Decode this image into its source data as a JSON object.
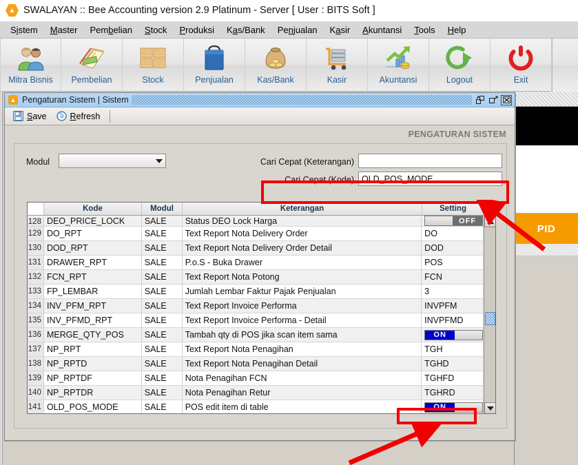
{
  "window": {
    "logo_icon": "hexagon-logo-icon",
    "title": "SWALAYAN :: Bee Accounting version 2.9 Platinum - Server  [ User : BITS Soft ]"
  },
  "menubar": {
    "items": [
      {
        "label": "Sistem",
        "mnemonic": "i"
      },
      {
        "label": "Master",
        "mnemonic": "M"
      },
      {
        "label": "Pembelian",
        "mnemonic": "b"
      },
      {
        "label": "Stock",
        "mnemonic": "S"
      },
      {
        "label": "Produksi",
        "mnemonic": "P"
      },
      {
        "label": "Kas/Bank",
        "mnemonic": "a"
      },
      {
        "label": "Penjualan",
        "mnemonic": "n"
      },
      {
        "label": "Kasir",
        "mnemonic": "a"
      },
      {
        "label": "Akuntansi",
        "mnemonic": "A"
      },
      {
        "label": "Tools",
        "mnemonic": "T"
      },
      {
        "label": "Help",
        "mnemonic": "H"
      }
    ]
  },
  "toolbar": {
    "buttons": [
      {
        "label": "Mitra Bisnis",
        "icon": "two-people-icon"
      },
      {
        "label": "Pembelian",
        "icon": "books-ledger-icon"
      },
      {
        "label": "Stock",
        "icon": "boxes-icon"
      },
      {
        "label": "Penjualan",
        "icon": "shopping-bag-icon"
      },
      {
        "label": "Kas/Bank",
        "icon": "money-bag-icon"
      },
      {
        "label": "Kasir",
        "icon": "cash-cart-icon"
      },
      {
        "label": "Akuntansi",
        "icon": "growth-chart-icon"
      },
      {
        "label": "Logout",
        "icon": "logout-arrow-icon"
      },
      {
        "label": "Exit",
        "icon": "power-off-icon"
      }
    ]
  },
  "mdi": {
    "icon": "hexagon-logo-icon",
    "title": "Pengaturan Sistem | Sistem",
    "window_buttons": [
      {
        "name": "restore-button",
        "glyph": "⤵"
      },
      {
        "name": "maximize-button",
        "glyph": "⤴"
      },
      {
        "name": "close-button",
        "glyph": "☒"
      }
    ],
    "tools": [
      {
        "label": "Save",
        "mnemonic": "S",
        "icon": "floppy-save-icon"
      },
      {
        "label": "Refresh",
        "mnemonic": "R",
        "icon": "refresh-circle-icon"
      }
    ],
    "page_title": "PENGATURAN SISTEM"
  },
  "form": {
    "modul_label": "Modul",
    "modul_value": "",
    "modul_placeholder": "",
    "cari_keterangan_label": "Cari Cepat (Keterangan)",
    "cari_keterangan_value": "",
    "cari_kode_label": "Cari Cepat (Kode)",
    "cari_kode_value": "OLD_POS_MODE"
  },
  "grid": {
    "columns": [
      "",
      "Kode",
      "Modul",
      "Keterangan",
      "Setting"
    ],
    "rows": [
      {
        "n": "128",
        "kode": "DEO_PRICE_LOCK",
        "modul": "SALE",
        "keterangan": "Status DEO Lock Harga",
        "setting": "OFF",
        "setting_type": "toggle"
      },
      {
        "n": "129",
        "kode": "DO_RPT",
        "modul": "SALE",
        "keterangan": "Text Report Nota Delivery Order",
        "setting": "DO",
        "setting_type": "text"
      },
      {
        "n": "130",
        "kode": "DOD_RPT",
        "modul": "SALE",
        "keterangan": "Text Report Nota Delivery Order Detail",
        "setting": "DOD",
        "setting_type": "text"
      },
      {
        "n": "131",
        "kode": "DRAWER_RPT",
        "modul": "SALE",
        "keterangan": "P.o.S - Buka Drawer",
        "setting": "POS",
        "setting_type": "text"
      },
      {
        "n": "132",
        "kode": "FCN_RPT",
        "modul": "SALE",
        "keterangan": "Text Report Nota Potong",
        "setting": "FCN",
        "setting_type": "text"
      },
      {
        "n": "133",
        "kode": "FP_LEMBAR",
        "modul": "SALE",
        "keterangan": "Jumlah Lembar Faktur Pajak Penjualan",
        "setting": "3",
        "setting_type": "text"
      },
      {
        "n": "134",
        "kode": "INV_PFM_RPT",
        "modul": "SALE",
        "keterangan": "Text Report Invoice Performa",
        "setting": "INVPFM",
        "setting_type": "text"
      },
      {
        "n": "135",
        "kode": "INV_PFMD_RPT",
        "modul": "SALE",
        "keterangan": "Text Report Invoice Performa - Detail",
        "setting": "INVPFMD",
        "setting_type": "text"
      },
      {
        "n": "136",
        "kode": "MERGE_QTY_POS",
        "modul": "SALE",
        "keterangan": "Tambah qty di POS jika scan item sama",
        "setting": "ON",
        "setting_type": "toggle"
      },
      {
        "n": "137",
        "kode": "NP_RPT",
        "modul": "SALE",
        "keterangan": "Text Report Nota Penagihan",
        "setting": "TGH",
        "setting_type": "text"
      },
      {
        "n": "138",
        "kode": "NP_RPTD",
        "modul": "SALE",
        "keterangan": "Text Report Nota Penagihan Detail",
        "setting": "TGHD",
        "setting_type": "text"
      },
      {
        "n": "139",
        "kode": "NP_RPTDF",
        "modul": "SALE",
        "keterangan": "Nota Penagihan FCN",
        "setting": "TGHFD",
        "setting_type": "text"
      },
      {
        "n": "140",
        "kode": "NP_RPTDR",
        "modul": "SALE",
        "keterangan": "Nota Penagihan Retur",
        "setting": "TGHRD",
        "setting_type": "text"
      },
      {
        "n": "141",
        "kode": "OLD_POS_MODE",
        "modul": "SALE",
        "keterangan": "POS edit item di table",
        "setting": "ON",
        "setting_type": "toggle"
      }
    ]
  },
  "background_window": {
    "badge_label": "PID"
  },
  "annotations": {
    "color": "#f10000",
    "highlight_code_field": "Cari Cepat (Kode) = OLD_POS_MODE",
    "highlight_toggle": "OLD_POS_MODE setting toggle = ON"
  }
}
